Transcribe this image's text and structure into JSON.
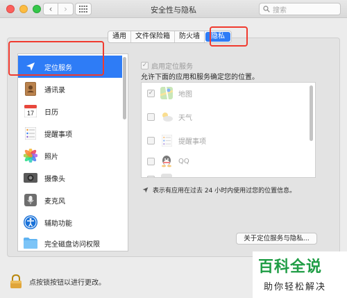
{
  "window": {
    "title": "安全性与隐私",
    "search_placeholder": "搜索"
  },
  "tabs": [
    {
      "label": "通用",
      "active": false
    },
    {
      "label": "文件保险箱",
      "active": false
    },
    {
      "label": "防火墙",
      "active": false
    },
    {
      "label": "隐私",
      "active": true
    }
  ],
  "sidebar": {
    "items": [
      {
        "label": "定位服务",
        "icon": "location-arrow-icon",
        "active": true
      },
      {
        "label": "通讯录",
        "icon": "contacts-icon",
        "active": false
      },
      {
        "label": "日历",
        "icon": "calendar-icon",
        "active": false,
        "icon_text": "17"
      },
      {
        "label": "提醒事项",
        "icon": "reminders-icon",
        "active": false
      },
      {
        "label": "照片",
        "icon": "photos-icon",
        "active": false
      },
      {
        "label": "摄像头",
        "icon": "camera-icon",
        "active": false
      },
      {
        "label": "麦克风",
        "icon": "microphone-icon",
        "active": false
      },
      {
        "label": "辅助功能",
        "icon": "accessibility-icon",
        "active": false
      },
      {
        "label": "完全磁盘访问权限",
        "icon": "folder-icon",
        "active": false
      }
    ]
  },
  "location": {
    "enable_label": "启用定位服务",
    "enable_checked": true,
    "description": "允许下面的应用和服务确定您的位置。",
    "apps": [
      {
        "name": "地图",
        "checked": true,
        "icon": "maps-icon"
      },
      {
        "name": "天气",
        "checked": false,
        "icon": "weather-icon"
      },
      {
        "name": "提醒事项",
        "checked": false,
        "icon": "reminders-icon"
      },
      {
        "name": "QQ",
        "checked": false,
        "icon": "qq-icon"
      },
      {
        "name": "",
        "checked": false,
        "icon": "app-icon"
      }
    ],
    "arrow_note": "表示有应用在过去 24 小时内使用过您的位置信息。",
    "about_button": "关于定位服务与隐私..."
  },
  "footer": {
    "lock_text": "点按锁按钮以进行更改。"
  },
  "watermark": {
    "main": "百科全说",
    "sub": "助你轻松解决"
  },
  "colors": {
    "accent": "#2e7cf6",
    "highlight_red": "#f03a2e",
    "watermark_green": "#1f9d45"
  }
}
